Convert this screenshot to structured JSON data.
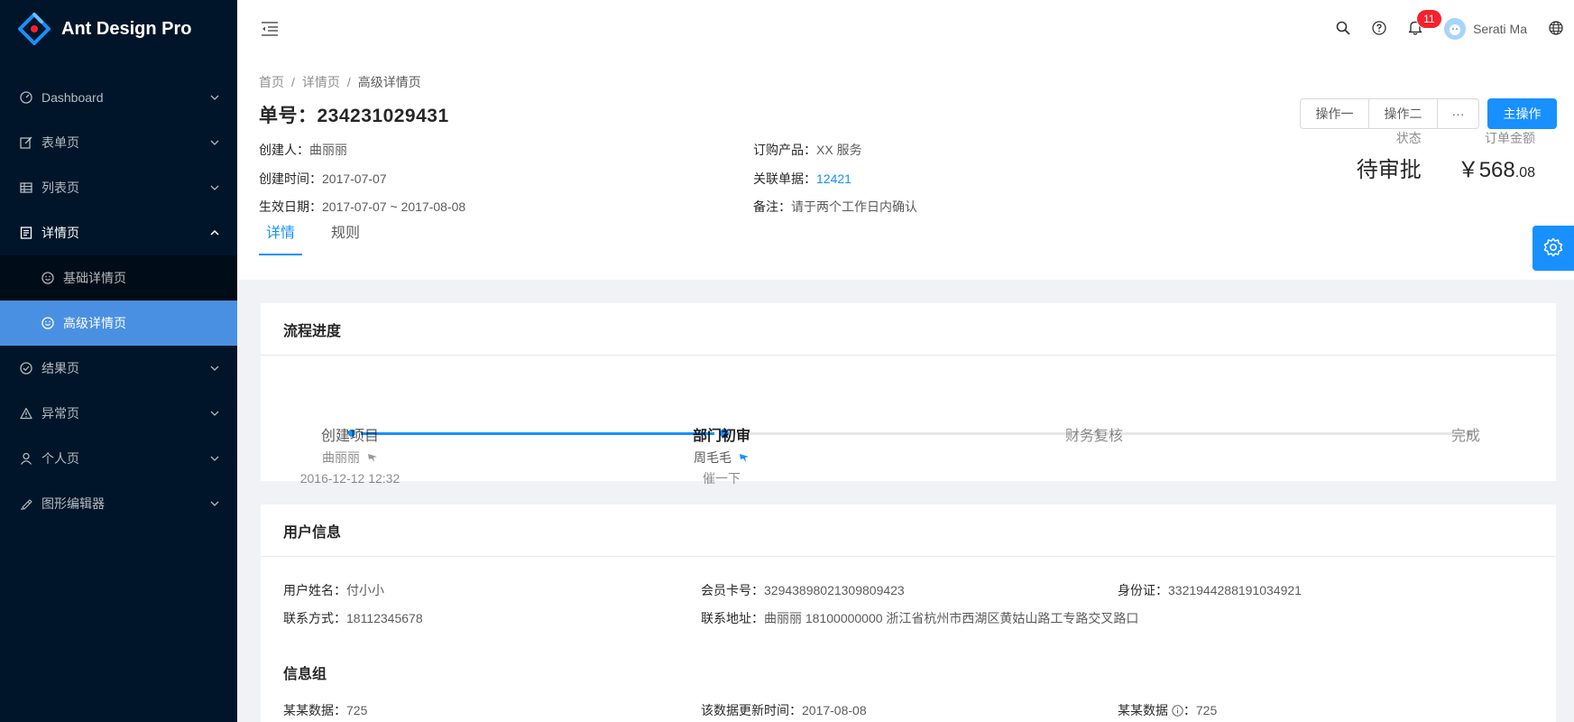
{
  "app": {
    "title": "Ant Design Pro"
  },
  "sidebar": {
    "items": [
      {
        "label": "Dashboard",
        "icon": "dashboard-icon"
      },
      {
        "label": "表单页",
        "icon": "form-icon"
      },
      {
        "label": "列表页",
        "icon": "table-icon"
      },
      {
        "label": "详情页",
        "icon": "profile-icon"
      },
      {
        "label": "基础详情页",
        "icon": "smile-icon"
      },
      {
        "label": "高级详情页",
        "icon": "smile-icon"
      },
      {
        "label": "结果页",
        "icon": "check-circle-icon"
      },
      {
        "label": "异常页",
        "icon": "warning-icon"
      },
      {
        "label": "个人页",
        "icon": "user-icon"
      },
      {
        "label": "图形编辑器",
        "icon": "highlight-icon"
      }
    ]
  },
  "header": {
    "notification_count": "11",
    "username": "Serati Ma"
  },
  "breadcrumb": [
    "首页",
    "/",
    "详情页",
    "/",
    "高级详情页"
  ],
  "page": {
    "title": "单号：234231029431",
    "actions": {
      "action1": "操作一",
      "action2": "操作二",
      "more": "···",
      "primary": "主操作"
    },
    "desc": {
      "creator_label": "创建人：",
      "creator": "曲丽丽",
      "created_label": "创建时间：",
      "created": "2017-07-07",
      "effective_label": "生效日期：",
      "effective": "2017-07-07 ~ 2017-08-08",
      "product_label": "订购产品：",
      "product": "XX 服务",
      "related_label": "关联单据：",
      "related": "12421",
      "remark_label": "备注：",
      "remark": "请于两个工作日内确认"
    },
    "extra": {
      "status_label": "状态",
      "status": "待审批",
      "amount_label": "订单金额",
      "amount_main": "￥568",
      "amount_decimal": ".08"
    },
    "tabs": [
      "详情",
      "规则"
    ]
  },
  "progress": {
    "title": "流程进度",
    "steps": [
      {
        "title": "创建项目",
        "person": "曲丽丽",
        "time": "2016-12-12 12:32"
      },
      {
        "title": "部门初审",
        "person": "周毛毛",
        "action": "催一下"
      },
      {
        "title": "财务复核"
      },
      {
        "title": "完成"
      }
    ]
  },
  "user_info": {
    "title": "用户信息",
    "name_label": "用户姓名：",
    "name": "付小小",
    "card_label": "会员卡号：",
    "card": "32943898021309809423",
    "id_label": "身份证：",
    "id": "3321944288191034921",
    "phone_label": "联系方式：",
    "phone": "18112345678",
    "address_label": "联系地址：",
    "address": "曲丽丽 18100000000 浙江省杭州市西湖区黄姑山路工专路交叉路口",
    "group_title": "信息组",
    "data1_label": "某某数据：",
    "data1": "725",
    "update_label": "该数据更新时间：",
    "update": "2017-08-08",
    "data2_label": "某某数据 ",
    "data2_colon": "：",
    "data2": "725"
  },
  "colors": {
    "primary": "#1890ff",
    "sider": "#001529",
    "selected": "#4a90e2"
  }
}
